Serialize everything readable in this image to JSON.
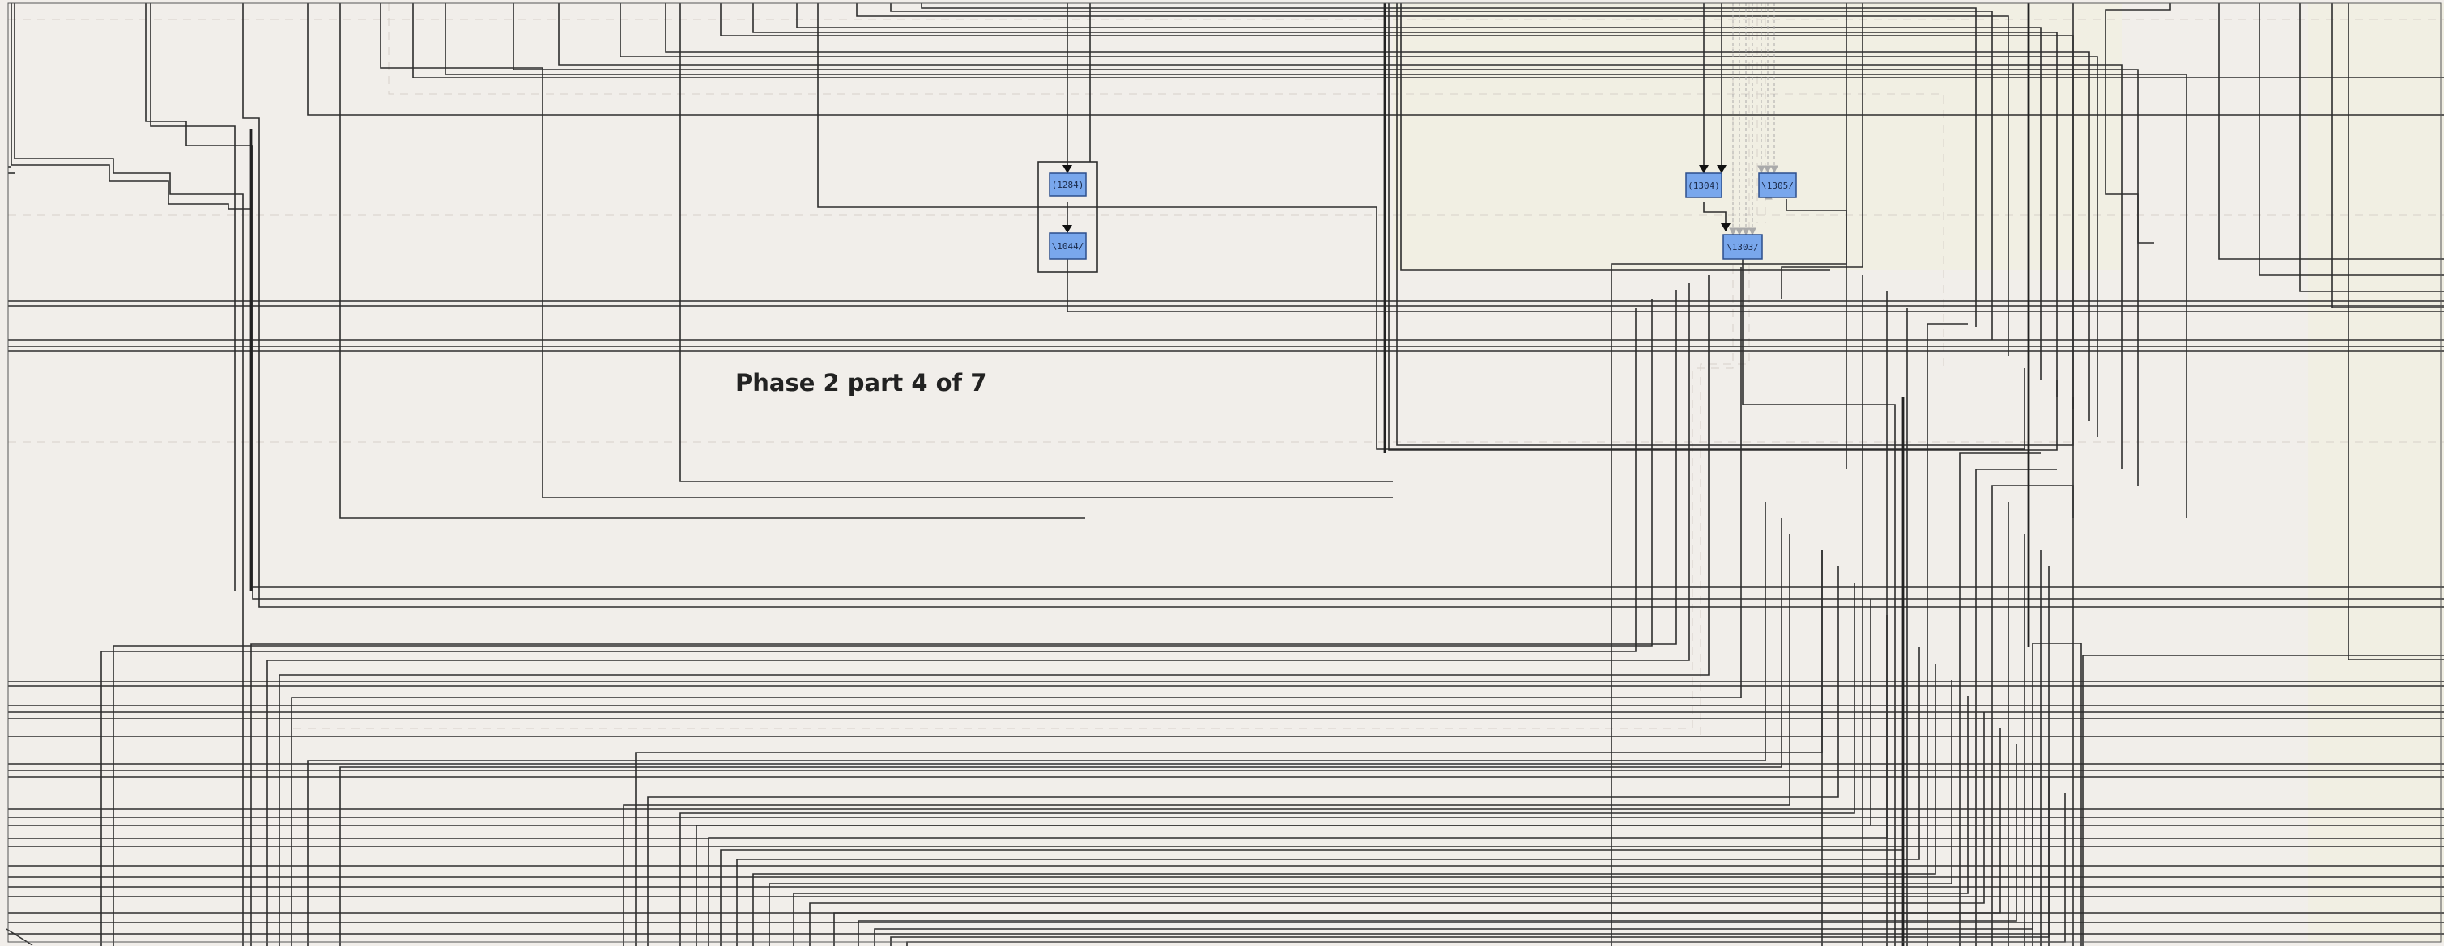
{
  "diagram": {
    "title": "Phase 2 part 4 of 7",
    "colors": {
      "background": "#f1eeea",
      "panel": "#f1efe3",
      "wire": "#2d2d2d",
      "dashed": "#c9c3bc",
      "node_fill": "#79a7ec",
      "node_border": "#2c4f8c"
    },
    "nodes": [
      {
        "id": "n1284",
        "label": "(1284)"
      },
      {
        "id": "n1044",
        "label": "\\1044/"
      },
      {
        "id": "n1304",
        "label": "(1304)"
      },
      {
        "id": "n1305",
        "label": "\\1305/"
      },
      {
        "id": "n1303",
        "label": "\\1303/"
      }
    ]
  }
}
